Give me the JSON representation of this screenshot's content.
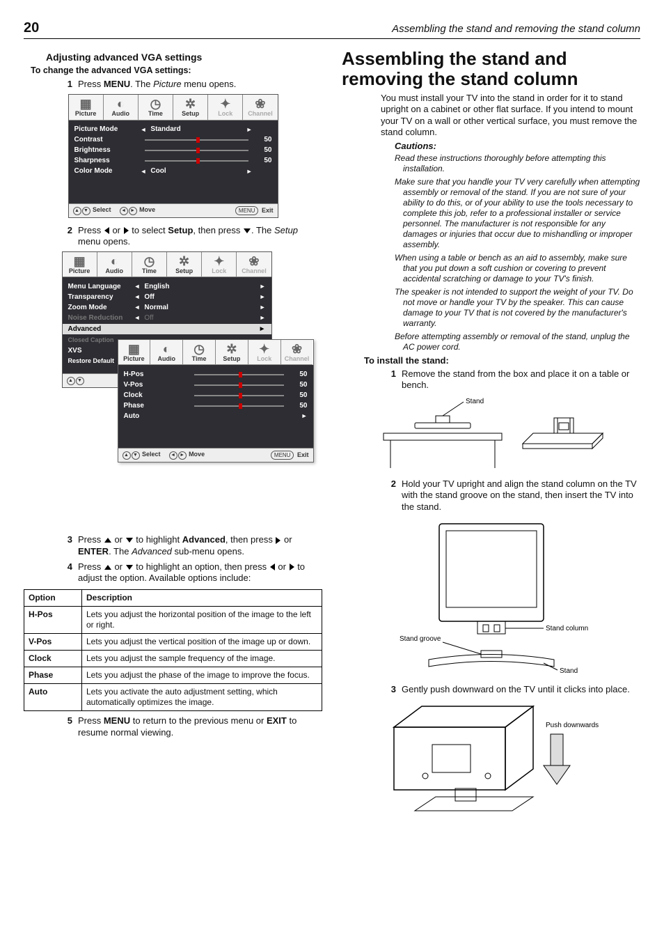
{
  "page_number": "20",
  "running_head": "Assembling the stand and removing the stand column",
  "left": {
    "heading": "Adjusting advanced VGA settings",
    "lead": "To change the advanced VGA settings:",
    "steps": {
      "s1_a": "Press ",
      "s1_b": "MENU",
      "s1_c": ". The ",
      "s1_d": "Picture",
      "s1_e": " menu opens.",
      "s2_a": "Press ",
      "s2_b": " or ",
      "s2_c": " to select ",
      "s2_d": "Setup",
      "s2_e": ", then press ",
      "s2_f": ". The ",
      "s2_g": "Setup",
      "s2_h": " menu opens.",
      "s3_a": "Press ",
      "s3_b": " or ",
      "s3_c": " to highlight ",
      "s3_d": "Advanced",
      "s3_e": ", then press ",
      "s3_f": " or ",
      "s3_g": "ENTER",
      "s3_h": ". The ",
      "s3_i": "Advanced",
      "s3_j": " sub-menu opens.",
      "s4_a": "Press ",
      "s4_b": " or ",
      "s4_c": " to highlight an option, then press ",
      "s4_d": " or ",
      "s4_e": " to adjust the option. Available options include:",
      "s5_a": "Press ",
      "s5_b": "MENU",
      "s5_c": " to return to the previous menu or ",
      "s5_d": "EXIT",
      "s5_e": " to resume normal viewing."
    },
    "osd_tabs": [
      "Picture",
      "Audio",
      "Time",
      "Setup",
      "Lock",
      "Channel"
    ],
    "osd1": {
      "rows": {
        "picture_mode": "Picture Mode",
        "picture_mode_val": "Standard",
        "contrast": "Contrast",
        "contrast_val": "50",
        "brightness": "Brightness",
        "brightness_val": "50",
        "sharpness": "Sharpness",
        "sharpness_val": "50",
        "color_mode": "Color Mode",
        "color_mode_val": "Cool"
      }
    },
    "osd2": {
      "rows": {
        "menu_language": "Menu Language",
        "menu_language_val": "English",
        "transparency": "Transparency",
        "transparency_val": "Off",
        "zoom_mode": "Zoom Mode",
        "zoom_mode_val": "Normal",
        "noise_reduction": "Noise Reduction",
        "noise_reduction_val": "Off",
        "advanced": "Advanced",
        "closed_caption": "Closed Caption",
        "xvs": "XVS",
        "restore": "Restore Default"
      }
    },
    "osd_sub": {
      "hpos": "H-Pos",
      "hpos_val": "50",
      "vpos": "V-Pos",
      "vpos_val": "50",
      "clock": "Clock",
      "clock_val": "50",
      "phase": "Phase",
      "phase_val": "50",
      "auto": "Auto"
    },
    "osd_footer": {
      "select": "Select",
      "move": "Move",
      "exit": "Exit",
      "menu": "MENU"
    },
    "table": {
      "h1": "Option",
      "h2": "Description",
      "r1k": "H-Pos",
      "r1v": "Lets you adjust the horizontal position of the image to the left or right.",
      "r2k": "V-Pos",
      "r2v": "Lets you adjust the vertical position of the image up or down.",
      "r3k": "Clock",
      "r3v": "Lets you adjust the sample frequency of the image.",
      "r4k": "Phase",
      "r4v": "Lets you adjust the phase of the image to improve the focus.",
      "r5k": "Auto",
      "r5v": "Lets you activate the auto adjustment setting, which automatically optimizes the image."
    }
  },
  "right": {
    "title": "Assembling the stand and removing the stand column",
    "intro": "You must install your TV into the stand in order for it to stand upright on a cabinet or other flat surface. If you intend to mount your TV on a wall or other vertical surface, you must remove the stand column.",
    "cautions_label": "Cautions:",
    "cautions": [
      "Read these instructions thoroughly before attempting this installation.",
      "Make sure that you handle your TV very carefully when attempting assembly or removal of the stand. If you are not sure of your ability to do this, or of your ability to use the tools necessary to complete this job, refer to a professional installer or service personnel. The manufacturer is not responsible for any damages or injuries that occur due to mishandling or improper assembly.",
      "When using a table or bench as an aid to assembly, make sure that you put down a soft cushion or covering to prevent accidental scratching or damage to your TV's finish.",
      "The speaker is not intended to support the weight of your TV. Do not move or handle your TV by the speaker. This can cause damage to your TV that is not covered by the manufacturer's warranty.",
      "Before attempting assembly or removal of the stand, unplug the AC power cord."
    ],
    "install_head": "To install the stand:",
    "steps": {
      "s1": "Remove the stand from the box and place it on a table or bench.",
      "s2": "Hold your TV upright and align the stand column on the TV with the stand groove on the stand, then insert the TV into the stand.",
      "s3": "Gently push downward on the TV until it clicks into place."
    },
    "labels": {
      "stand": "Stand",
      "stand_column": "Stand column",
      "stand_groove": "Stand groove",
      "push": "Push downwards"
    }
  }
}
